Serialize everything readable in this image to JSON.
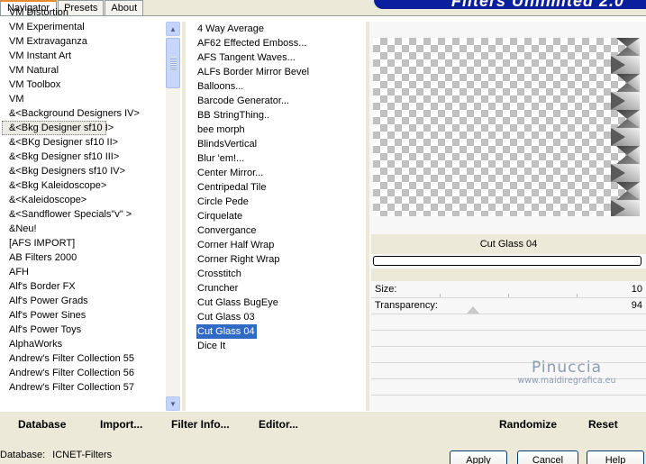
{
  "tabs": [
    {
      "label": "Navigator",
      "active": true
    },
    {
      "label": "Presets",
      "active": false
    },
    {
      "label": "About",
      "active": false
    }
  ],
  "app_title": "Filters Unlimited 2.0",
  "categories": [
    "VM Distortion",
    "VM Experimental",
    "VM Extravaganza",
    "VM Instant Art",
    "VM Natural",
    "VM Toolbox",
    "VM",
    "&<Background Designers IV>",
    "&<Bkg Designer sf10 I>",
    "&<BKg Designer sf10 II>",
    "&<Bkg Designer sf10 III>",
    "&<Bkg Designers sf10 IV>",
    "&<Bkg Kaleidoscope>",
    "&<Kaleidoscope>",
    "&<Sandflower Specials\"v\" >",
    "&Neu!",
    "[AFS IMPORT]",
    "AB Filters 2000",
    "AFH",
    "Alf's Border FX",
    "Alf's Power Grads",
    "Alf's Power Sines",
    "Alf's Power Toys",
    "AlphaWorks",
    "Andrew's Filter Collection 55",
    "Andrew's Filter Collection 56",
    "Andrew's Filter Collection 57"
  ],
  "selected_category": "&<Bkg Designer sf10 I>",
  "filters": [
    "4 Way Average",
    "AF62 Effected Emboss...",
    "AFS Tangent Waves...",
    "ALFs Border Mirror Bevel",
    "Balloons...",
    "Barcode Generator...",
    "BB StringThing..",
    "bee morph",
    "BlindsVertical",
    "Blur 'em!...",
    "Center Mirror...",
    "Centripedal Tile",
    "Circle Pede",
    "Cirquelate",
    "Convergance",
    "Corner Half Wrap",
    "Corner Right Wrap",
    "Crosstitch",
    "Cruncher",
    "Cut Glass  BugEye",
    "Cut Glass 03",
    "Cut Glass 04",
    "Dice It"
  ],
  "selected_filter": "Cut Glass 04",
  "preview": {
    "filter_name": "Cut Glass 04",
    "params": [
      {
        "label": "Size:",
        "value": "10"
      },
      {
        "label": "Transparency:",
        "value": "94"
      }
    ],
    "watermark_title": "Pinuccia",
    "watermark_url": "www.maidiregrafica.eu"
  },
  "buttons": {
    "database": "Database",
    "import": "Import...",
    "filter_info": "Filter Info...",
    "editor": "Editor...",
    "randomize": "Randomize",
    "reset": "Reset"
  },
  "status": {
    "label": "Database:",
    "value": "ICNET-Filters"
  },
  "dialog_buttons": {
    "apply": "Apply",
    "cancel": "Cancel",
    "help": "Help"
  },
  "colors": {
    "selection": "#316ac5",
    "title_banner": "#0b1f9e",
    "tab_accent": "#e68b2c"
  }
}
